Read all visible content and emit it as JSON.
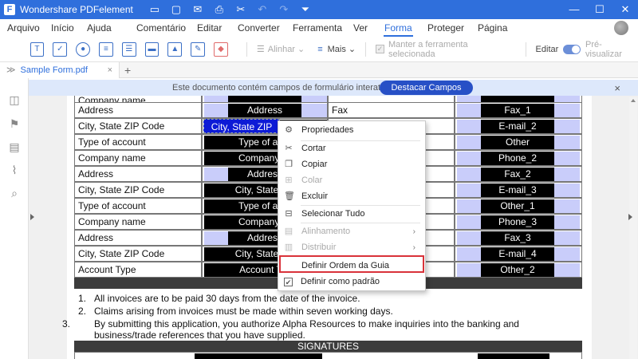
{
  "app": {
    "title": "Wondershare PDFelement",
    "logo_letter": "F"
  },
  "menu": [
    "Arquivo",
    "Início",
    "Ajuda",
    "Comentário",
    "Editar",
    "Converter",
    "Ferramenta",
    "Ver",
    "Forma",
    "Proteger",
    "Página"
  ],
  "active_menu": "Forma",
  "toolbar": {
    "align_label": "Alinhar",
    "more_label": "Mais",
    "keep_tool_label": "Manter a ferramenta selecionada",
    "edit_label": "Editar",
    "preview_label": "Pré-visualizar"
  },
  "tab": {
    "label": "Sample Form.pdf",
    "close": "×",
    "add": "+"
  },
  "notification": {
    "text": "Este documento contém campos de formulário interativos.",
    "button": "Destacar Campos",
    "close": "×"
  },
  "form": {
    "top_partial": "Company name",
    "rows": [
      {
        "label": "Address",
        "field": "Address",
        "mid": "Fax",
        "right": "Fax_1"
      },
      {
        "label": "City, State ZIP Code",
        "field": "City, State ZIP",
        "mid": "",
        "right": "E-mail_2"
      },
      {
        "label": "Type of account",
        "field": "Type of acco",
        "mid": "",
        "right": "Other"
      },
      {
        "label": "Company name",
        "field": "Company na",
        "mid": "",
        "right": "Phone_2"
      },
      {
        "label": "Address",
        "field": "Address",
        "mid": "",
        "right": "Fax_2"
      },
      {
        "label": "City, State ZIP Code",
        "field": "City, State ZIP",
        "mid": "",
        "right": "E-mail_3"
      },
      {
        "label": "Type of account",
        "field": "Type of acco",
        "mid": "",
        "right": "Other_1"
      },
      {
        "label": "Company name",
        "field": "Company na",
        "mid": "",
        "right": "Phone_3"
      },
      {
        "label": "Address",
        "field": "Address",
        "mid": "",
        "right": "Fax_3"
      },
      {
        "label": "City, State ZIP Code",
        "field": "City, State ZIP",
        "mid": "",
        "right": "E-mail_4"
      },
      {
        "label": "Account Type",
        "field": "Account Typ",
        "mid": "",
        "right": "Other_2"
      }
    ]
  },
  "terms": [
    {
      "num": "1.",
      "text": "All invoices are to be paid 30 days from the date of the invoice."
    },
    {
      "num": "2.",
      "text": "Claims arising from invoices must be made within seven working days."
    },
    {
      "num": "3.",
      "text": "By submitting this application, you authorize Alpha Resources to make inquiries into the banking and business/trade references that you have supplied."
    }
  ],
  "signatures": "SIGNATURES",
  "context_menu": {
    "items": [
      {
        "label": "Propriedades",
        "icon": "gear-icon",
        "glyph": "⚙",
        "disabled": false,
        "submenu": false
      },
      {
        "label": "Cortar",
        "icon": "scissors-icon",
        "glyph": "✂",
        "disabled": false,
        "submenu": false
      },
      {
        "label": "Copiar",
        "icon": "copy-icon",
        "glyph": "❐",
        "disabled": false,
        "submenu": false
      },
      {
        "label": "Colar",
        "icon": "paste-icon",
        "glyph": "⊞",
        "disabled": true,
        "submenu": false
      },
      {
        "label": "Excluir",
        "icon": "trash-icon",
        "glyph": "🗑",
        "disabled": false,
        "submenu": false
      },
      {
        "label": "Selecionar Tudo",
        "icon": "select-all-icon",
        "glyph": "⊟",
        "disabled": false,
        "submenu": false
      },
      {
        "label": "Alinhamento",
        "icon": "align-icon",
        "glyph": "▤",
        "disabled": true,
        "submenu": true
      },
      {
        "label": "Distribuir",
        "icon": "distribute-icon",
        "glyph": "▥",
        "disabled": true,
        "submenu": true
      },
      {
        "label": "Definir Ordem da Guia",
        "icon": "",
        "glyph": "",
        "disabled": false,
        "submenu": false
      },
      {
        "label": "Definir como padrão",
        "icon": "checkbox-checked-icon",
        "glyph": "✔",
        "disabled": false,
        "submenu": false
      }
    ],
    "highlighted": "Definir Ordem da Guia",
    "highlight_color": "#d9323a"
  },
  "colors": {
    "brand": "#2f6fdc",
    "field_black": "#000000",
    "field_blue": "#c9cdfa",
    "field_selected": "#0d1bd6",
    "notify_bg": "#dde8fb",
    "notify_button": "#2750c6"
  }
}
